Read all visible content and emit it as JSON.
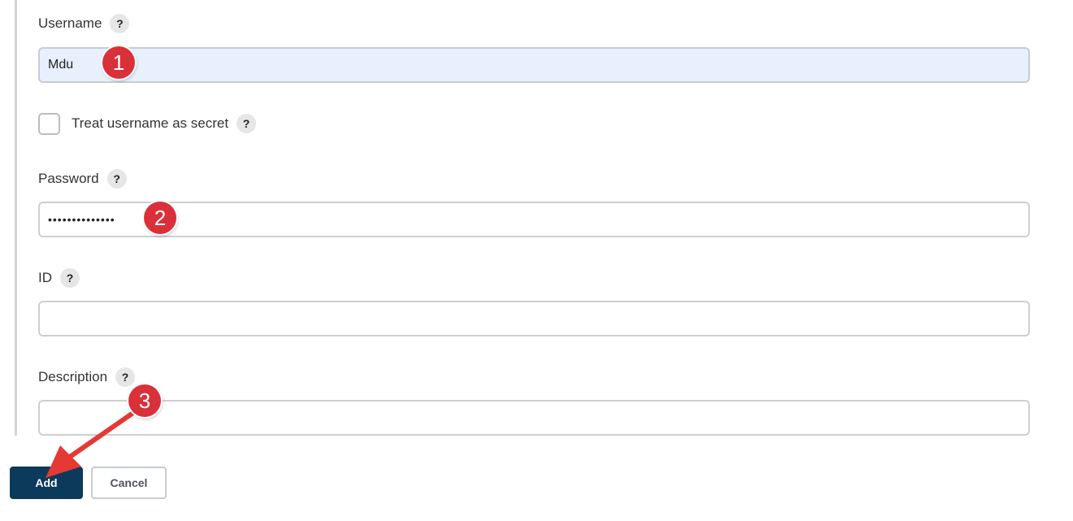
{
  "form": {
    "username": {
      "label": "Username",
      "help": "?",
      "value": "Mdu"
    },
    "treat_secret": {
      "label": "Treat username as secret",
      "help": "?",
      "checked": false
    },
    "password": {
      "label": "Password",
      "help": "?",
      "value": "••••••••••••••"
    },
    "id": {
      "label": "ID",
      "help": "?",
      "value": ""
    },
    "description": {
      "label": "Description",
      "help": "?",
      "value": ""
    }
  },
  "buttons": {
    "add": "Add",
    "cancel": "Cancel"
  },
  "annotations": {
    "step1": "1",
    "step2": "2",
    "step3": "3",
    "color": "#d9303a"
  }
}
